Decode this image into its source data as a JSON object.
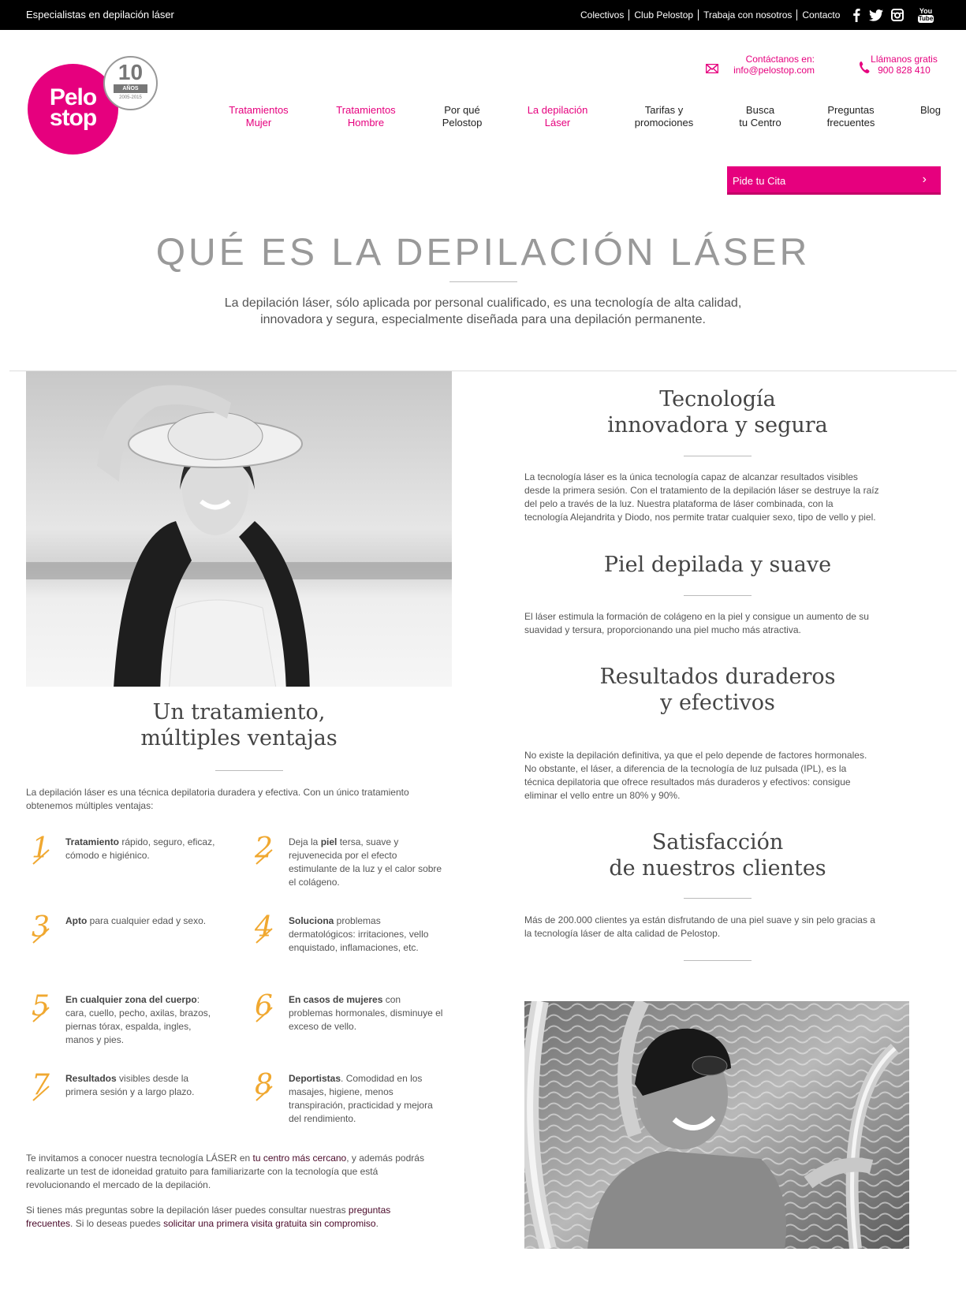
{
  "topbar": {
    "tagline": "Especialistas en depilación láser",
    "links": [
      "Colectivos",
      "Club Pelostop",
      "Trabaja con nosotros",
      "Contacto"
    ],
    "social_icons": [
      "facebook-icon",
      "twitter-icon",
      "instagram-icon",
      "youtube-icon"
    ],
    "youtube_text": [
      "You",
      "Tube"
    ]
  },
  "header": {
    "logo": {
      "line1": "Pelo",
      "line2": "stop"
    },
    "badge": {
      "number": "10",
      "label": "AÑOS",
      "years": "2005-2015"
    },
    "contact_mail": {
      "label": "Contáctanos en:",
      "value": "info@pelostop.com"
    },
    "contact_phone": {
      "label": "Llámanos gratis",
      "value": "900 828 410"
    },
    "nav": [
      {
        "line1": "Tratamientos",
        "line2": "Mujer"
      },
      {
        "line1": "Tratamientos",
        "line2": "Hombre"
      },
      {
        "line1": "Por qué",
        "line2": "Pelostop"
      },
      {
        "line1": "La depilación",
        "line2": "Láser"
      },
      {
        "line1": "Tarifas y",
        "line2": "promociones"
      },
      {
        "line1": "Busca",
        "line2": "tu Centro"
      },
      {
        "line1": "Preguntas",
        "line2": "frecuentes"
      },
      {
        "line1": "Blog",
        "line2": ""
      }
    ],
    "cta": {
      "label": "Pide tu Cita",
      "arrow": "›"
    }
  },
  "hero": {
    "title": "QUÉ ES LA DEPILACIÓN LÁSER",
    "subtitle_line1": "La depilación láser, sólo aplicada por personal cualificado, es una tecnología de alta calidad,",
    "subtitle_line2": "innovadora y segura, especialmente diseñada para una depilación permanente."
  },
  "left": {
    "heading_line1": "Un tratamiento,",
    "heading_line2": "múltiples ventajas",
    "intro_line1": "La depilación láser es una técnica depilatoria duradera y efectiva. Con un único tratamiento",
    "intro_line2": "obtenemos múltiples ventajas:",
    "advantages": [
      {
        "num": "1",
        "bold": "Tratamiento",
        "lines": [
          " rápido, seguro, eficaz,",
          "cómodo e higiénico."
        ]
      },
      {
        "num": "2",
        "pre": "Deja la ",
        "bold": "piel",
        "lines": [
          " tersa, suave y",
          "rejuvenecida por el efecto",
          "estimulante de la luz y el calor sobre",
          "el colágeno."
        ]
      },
      {
        "num": "3",
        "bold": "Apto",
        "lines": [
          " para cualquier edad y sexo."
        ]
      },
      {
        "num": "4",
        "bold": "Soluciona",
        "lines": [
          " problemas",
          "dermatológicos: irritaciones, vello",
          "enquistado, inflamaciones, etc."
        ]
      },
      {
        "num": "5",
        "bold": "En cualquier zona del cuerpo",
        "lines": [
          ":",
          "cara, cuello, pecho, axilas, brazos,",
          "piernas tórax, espalda, ingles,",
          "manos y pies."
        ]
      },
      {
        "num": "6",
        "bold": "En casos de mujeres",
        "lines": [
          " con",
          "problemas hormonales, disminuye el",
          "exceso de vello."
        ]
      },
      {
        "num": "7",
        "bold": "Resultados",
        "lines": [
          " visibles desde la",
          "primera sesión y a largo plazo."
        ]
      },
      {
        "num": "8",
        "bold": "Deportistas",
        "lines": [
          ". Comodidad en los",
          "masajes, higiene, menos",
          "transpiración, practicidad y mejora",
          "del rendimiento."
        ]
      }
    ],
    "invite": {
      "l1a": "Te invitamos a conocer nuestra tecnología LÁSER en ",
      "l1link": "tu centro más cercano",
      "l1b": ", y además podrás",
      "l2": "realizarte un test de idoneidad gratuito para familiarizarte con la tecnología que está",
      "l3": "revolucionando el mercado de la depilación."
    },
    "faq": {
      "l1a": "Si tienes más preguntas sobre la depilación láser puedes consultar nuestras ",
      "l1link": "preguntas",
      "l2link": "frecuentes",
      "l2b": ". Si lo deseas puedes ",
      "l2link2": "solicitar una primera visita gratuita sin compromiso",
      "l2c": "."
    }
  },
  "right": {
    "sections": [
      {
        "h1": "Tecnología",
        "h2": "innovadora y segura",
        "p": [
          "La tecnología láser es la única tecnología capaz de alcanzar resultados visibles",
          "desde la primera sesión. Con el tratamiento de la depilación láser se destruye la raíz",
          "del pelo a través de la luz. Nuestra plataforma de láser combinada, con la",
          "tecnología Alejandrita y Diodo, nos permite tratar cualquier sexo, tipo de vello y piel."
        ]
      },
      {
        "h1": "Piel depilada y suave",
        "h2": "",
        "p": [
          "El láser estimula la formación de colágeno en la piel y consigue un aumento de su",
          "suavidad y tersura, proporcionando una piel mucho más atractiva."
        ]
      },
      {
        "h1": "Resultados duraderos",
        "h2": "y efectivos",
        "p": [
          "No existe la depilación definitiva, ya que el pelo depende de factores hormonales.",
          "No obstante, el láser, a diferencia de la tecnología de luz pulsada (IPL), es la",
          "técnica depilatoria que ofrece resultados más duraderos y efectivos: consigue",
          "eliminar el vello entre un 80% y 90%."
        ]
      },
      {
        "h1": "Satisfacción",
        "h2": "de nuestros clientes",
        "p": [
          "Más de 200.000 clientes ya están disfrutando de una piel suave y sin pelo gracias a",
          "la tecnología láser de alta calidad de Pelostop."
        ]
      }
    ]
  }
}
